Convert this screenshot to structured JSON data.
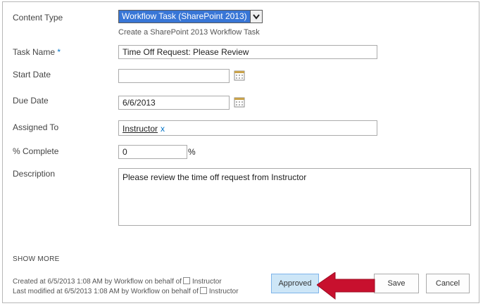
{
  "form": {
    "content_type": {
      "label": "Content Type",
      "selected": "Workflow Task (SharePoint 2013)",
      "hint": "Create a SharePoint 2013 Workflow Task"
    },
    "task_name": {
      "label": "Task Name",
      "required_marker": "*",
      "value": "Time Off Request: Please Review"
    },
    "start_date": {
      "label": "Start Date",
      "value": ""
    },
    "due_date": {
      "label": "Due Date",
      "value": "6/6/2013"
    },
    "assigned_to": {
      "label": "Assigned To",
      "person": "Instructor",
      "remove_glyph": "x"
    },
    "percent_complete": {
      "label": "% Complete",
      "value": "0",
      "unit": "%"
    },
    "description": {
      "label": "Description",
      "value": "Please review the time off request from Instructor"
    }
  },
  "show_more": "SHOW MORE",
  "footer": {
    "created": {
      "text": "Created at 6/5/2013 1:08 AM  by Workflow on behalf of",
      "user": "Instructor"
    },
    "modified": {
      "text": "Last modified at 6/5/2013 1:08 AM  by Workflow on behalf of",
      "user": "Instructor"
    }
  },
  "buttons": {
    "approved": "Approved",
    "save": "Save",
    "cancel": "Cancel"
  },
  "colors": {
    "highlight": "#3876d6",
    "accent": "#0072c6",
    "annotation_arrow": "#c8102e"
  },
  "icons": {
    "calendar": "calendar-icon",
    "dropdown": "chevron-down-icon",
    "checkbox": "presence-checkbox-icon"
  }
}
